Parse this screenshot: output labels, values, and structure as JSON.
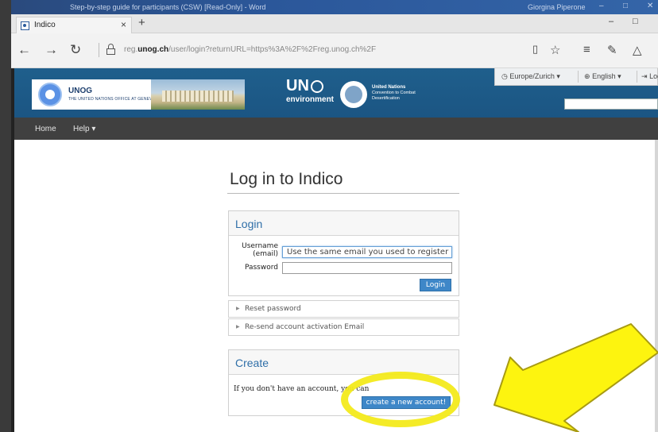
{
  "word": {
    "title": "Step-by-step guide for participants (CSW) [Read-Only]  -  Word",
    "user": "Giorgina Piperone"
  },
  "browser": {
    "tab_label": "Indico",
    "url_prefix": "reg.",
    "url_domain": "unog.ch",
    "url_rest": "/user/login?returnURL=https%3A%2F%2Freg.unog.ch%2F"
  },
  "header": {
    "unog_name": "UNOG",
    "unog_subtitle": "THE UNITED NATIONS OFFICE AT GENEVA",
    "un_env_big": "UN",
    "un_env_small": "environment",
    "unccd_line1": "United Nations",
    "unccd_line2": "Convention to Combat",
    "unccd_line3": "Desertification",
    "timezone": "Europe/Zurich",
    "language": "English",
    "login_link": "Log"
  },
  "nav": {
    "home": "Home",
    "help": "Help"
  },
  "page": {
    "title": "Log in to Indico"
  },
  "login": {
    "heading": "Login",
    "username_label_1": "Username",
    "username_label_2": "(email)",
    "username_value": "Use the same email you used to register",
    "password_label": "Password",
    "button": "Login"
  },
  "links": {
    "reset_password": "Reset password",
    "resend_activation": "Re-send account activation Email"
  },
  "create": {
    "heading": "Create",
    "text": "If you don't have an account, you can",
    "button": "create a new account!"
  },
  "colors": {
    "banner": "#1f5f8c",
    "navbar": "#404040",
    "accent_blue": "#3e87c8",
    "highlight_yellow": "#f3ea1b"
  }
}
